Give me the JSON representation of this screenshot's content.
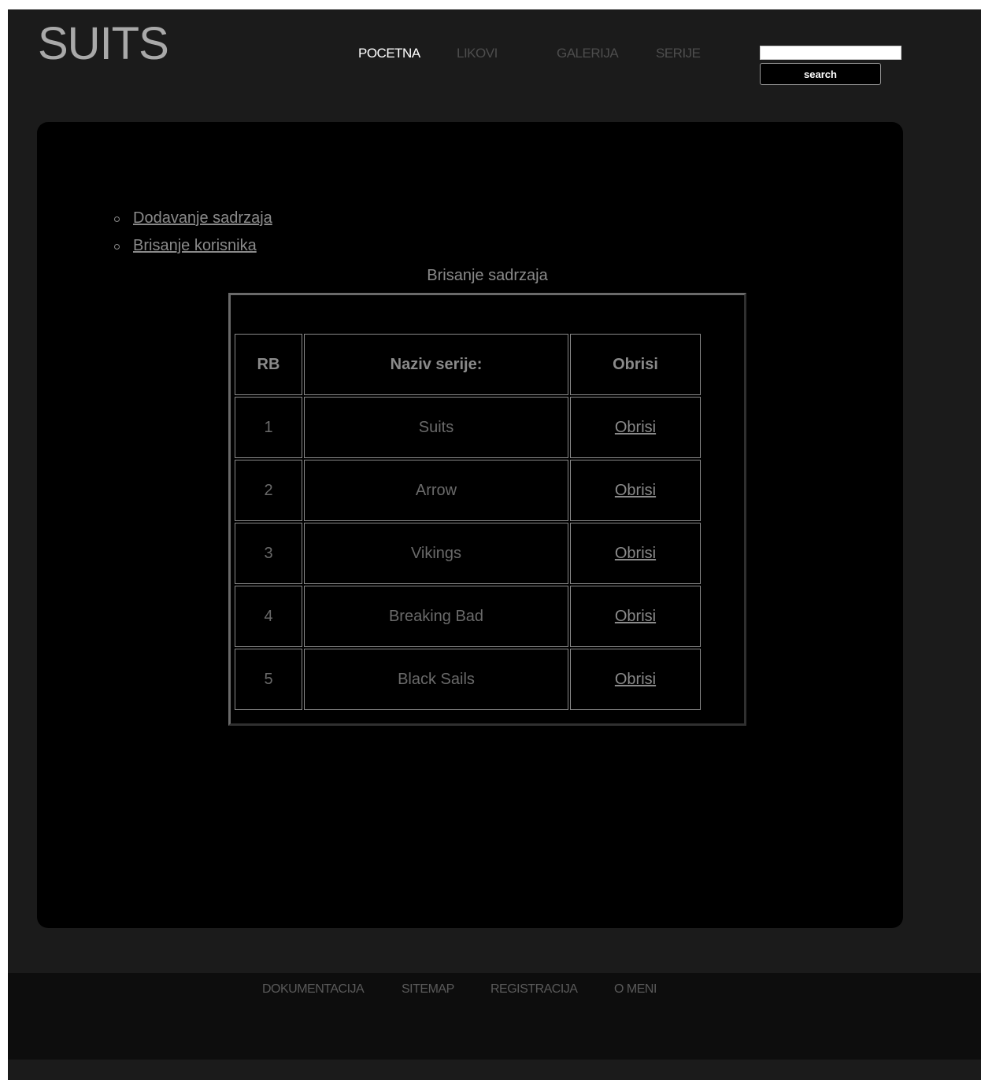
{
  "header": {
    "logo": "SUITS",
    "nav": [
      {
        "label": "POCETNA",
        "active": true
      },
      {
        "label": "LIKOVI",
        "active": false
      },
      {
        "label": "GALERIJA",
        "active": false
      },
      {
        "label": "SERIJE",
        "active": false
      }
    ],
    "search": {
      "value": "",
      "button_label": "search"
    }
  },
  "admin_menu": [
    {
      "label": "Dodavanje sadrzaja"
    },
    {
      "label": "Brisanje korisnika"
    }
  ],
  "table": {
    "caption": "Brisanje sadrzaja",
    "headers": [
      "RB",
      "Naziv serije:",
      "Obrisi"
    ],
    "rows": [
      {
        "rb": "1",
        "naziv": "Suits",
        "action": "Obrisi"
      },
      {
        "rb": "2",
        "naziv": "Arrow",
        "action": "Obrisi"
      },
      {
        "rb": "3",
        "naziv": "Vikings",
        "action": "Obrisi"
      },
      {
        "rb": "4",
        "naziv": "Breaking Bad",
        "action": "Obrisi"
      },
      {
        "rb": "5",
        "naziv": "Black Sails",
        "action": "Obrisi"
      }
    ]
  },
  "footer": {
    "links": [
      "DOKUMENTACIJA",
      "SITEMAP",
      "REGISTRACIJA",
      "O MENI"
    ]
  }
}
